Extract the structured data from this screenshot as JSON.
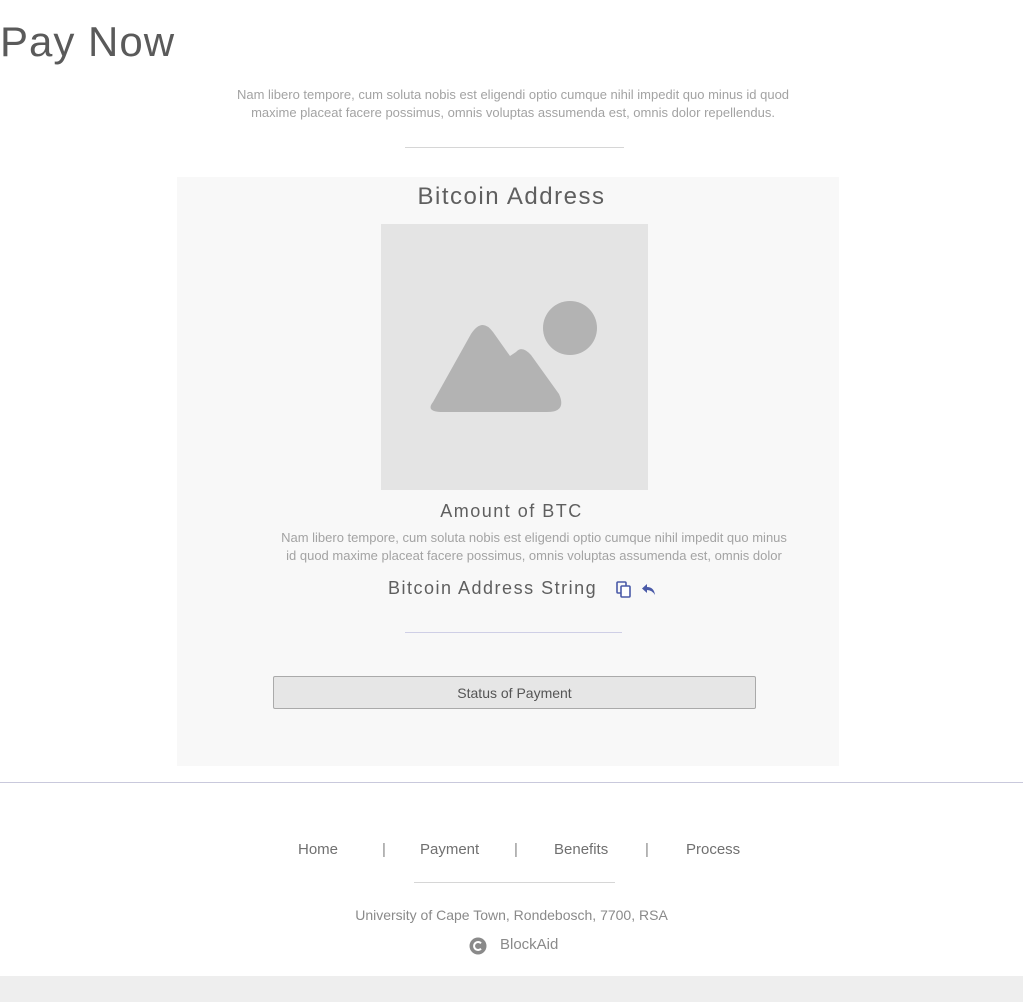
{
  "header": {
    "title": "Pay Now",
    "intro": "Nam libero tempore, cum soluta nobis est eligendi optio cumque nihil impedit quo minus id quod maxime placeat facere possimus, omnis voluptas assumenda est, omnis dolor repellendus."
  },
  "payment_panel": {
    "title": "Bitcoin Address",
    "image_icon": "image-placeholder-icon",
    "amount_label": "Amount of BTC",
    "amount_description": "Nam libero tempore, cum soluta nobis est eligendi optio cumque nihil impedit quo minus id quod maxime placeat facere possimus, omnis voluptas assumenda est, omnis dolor",
    "address_string": "Bitcoin Address String",
    "copy_icon": "copy-icon",
    "share_icon": "reply-icon",
    "status_button_label": "Status of Payment"
  },
  "footer": {
    "nav": [
      {
        "label": "Home"
      },
      {
        "label": "Payment"
      },
      {
        "label": "Benefits"
      },
      {
        "label": "Process"
      }
    ],
    "separator": "|",
    "address": "University of Cape Town, Rondebosch, 7700, RSA",
    "copyright_icon": "copyright-icon",
    "brand": "BlockAid"
  },
  "colors": {
    "accent_icon": "#4a5aa8",
    "panel_background": "#f8f8f8",
    "placeholder_background": "#e4e4e4",
    "placeholder_shape": "#b3b3b3"
  }
}
